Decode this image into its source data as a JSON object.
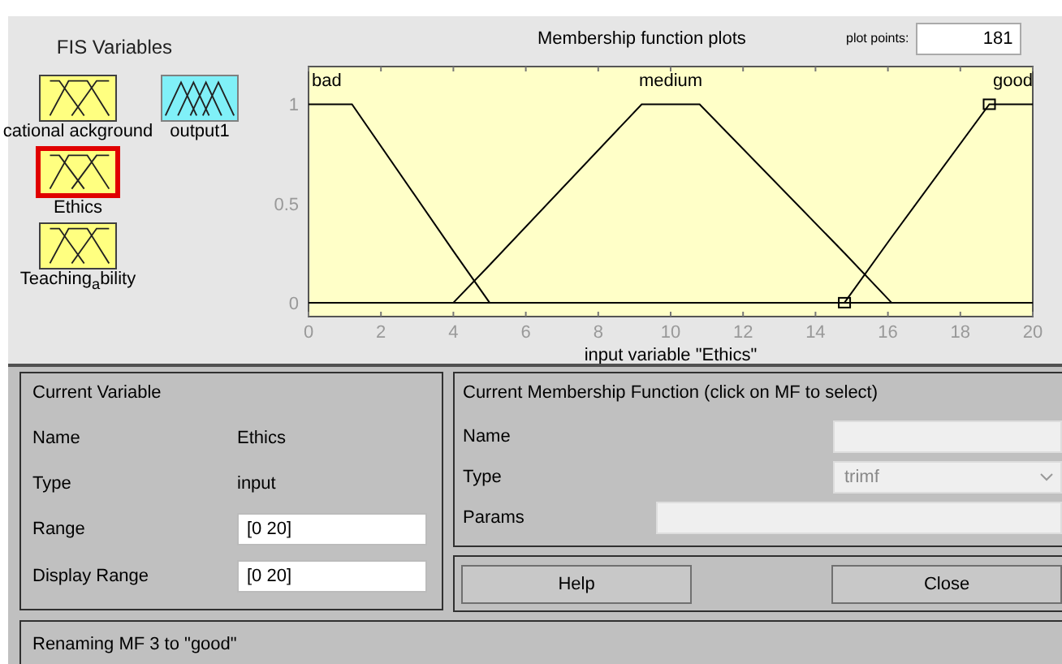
{
  "fis_variables": {
    "title": "FIS Variables",
    "items": [
      {
        "name": "cational ackground",
        "kind": "input",
        "selected": false
      },
      {
        "name": "output1",
        "kind": "output",
        "selected": false
      },
      {
        "name": "Ethics",
        "kind": "input",
        "selected": true
      },
      {
        "name": "Teaching$_{a}$bility",
        "kind": "input",
        "selected": false
      }
    ]
  },
  "plot": {
    "title": "Membership function plots",
    "plot_points_label": "plot points:",
    "plot_points": "181",
    "mf_states": [
      {
        "selected": false
      },
      {
        "selected": false
      },
      {
        "selected": true
      }
    ],
    "chart_data": {
      "type": "line",
      "xlabel": "input variable \"Ethics\"",
      "x": [
        0,
        1.2,
        4,
        5,
        9.2,
        10.8,
        14.8,
        16.1,
        18.8,
        20
      ],
      "series": [
        {
          "name": "bad",
          "color": "#000000",
          "values": [
            1,
            1,
            0.26,
            0,
            null,
            null,
            null,
            null,
            null,
            null
          ]
        },
        {
          "name": "medium",
          "color": "#000000",
          "values": [
            null,
            null,
            0,
            0.19,
            1,
            1,
            0.25,
            0,
            null,
            null
          ]
        },
        {
          "name": "good",
          "color": "#000000",
          "values": [
            null,
            null,
            null,
            null,
            null,
            null,
            0,
            0.33,
            1,
            1
          ]
        }
      ],
      "xlim": [
        0,
        20
      ],
      "ylim": [
        -0.07,
        1.19
      ],
      "xticks": [
        0,
        2,
        4,
        6,
        8,
        10,
        12,
        14,
        16,
        18,
        20
      ],
      "yticks": [
        0,
        {
          "value": 0.5,
          "label": "0.5"
        },
        1
      ]
    }
  },
  "current_variable": {
    "title": "Current Variable",
    "rows": [
      {
        "label": "Name",
        "value": "Ethics",
        "kind": "text"
      },
      {
        "label": "Type",
        "value": "input",
        "kind": "text"
      },
      {
        "label": "Range",
        "value": "[0 20]",
        "kind": "field"
      },
      {
        "label": "Display Range",
        "value": "[0 20]",
        "kind": "field"
      }
    ]
  },
  "current_mf": {
    "title": "Current Membership Function (click on MF to select)",
    "rows": [
      {
        "label": "Name",
        "kind": "field",
        "value": "",
        "disabled": true
      },
      {
        "label": "Type",
        "kind": "select",
        "value": "trimf",
        "disabled": true
      },
      {
        "label": "Params",
        "kind": "wide-field",
        "value": "",
        "disabled": true
      }
    ]
  },
  "buttons": [
    "Help",
    "Close"
  ],
  "status_bar": "Renaming MF 3 to \"good\""
}
